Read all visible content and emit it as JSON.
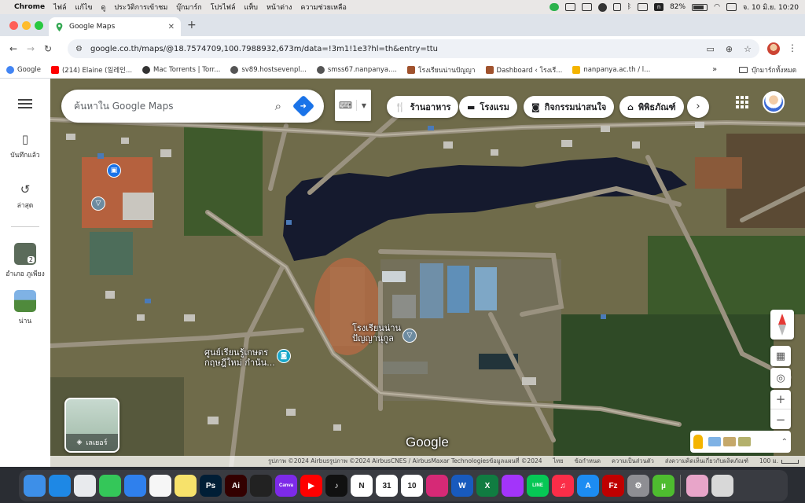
{
  "menubar": {
    "items": [
      "Chrome",
      "ไฟล์",
      "แก้ไข",
      "ดู",
      "ประวัติการเข้าชม",
      "บุ๊กมาร์ก",
      "โปรไฟล์",
      "แท็บ",
      "หน้าต่าง",
      "ความช่วยเหลือ"
    ],
    "battery": "82%",
    "clock": "จ. 10 มิ.ย.  10:20"
  },
  "browser": {
    "tab_title": "Google Maps",
    "url": "google.co.th/maps/@18.7574709,100.7988932,673m/data=!3m1!1e3?hl=th&entry=ttu",
    "bookmarks": [
      {
        "label": "Google",
        "color": "#4285f4"
      },
      {
        "label": "(214) Elaine (일레인...",
        "color": "#ff0000"
      },
      {
        "label": "Mac Torrents | Torr...",
        "color": "#333333"
      },
      {
        "label": "sv89.hostsevenpl...",
        "color": "#555555"
      },
      {
        "label": "smss67.nanpanya....",
        "color": "#555555"
      },
      {
        "label": "โรงเรียนน่านปัญญา",
        "color": "#a0522d"
      },
      {
        "label": "Dashboard ‹ โรงเรี...",
        "color": "#a0522d"
      },
      {
        "label": "nanpanya.ac.th / l...",
        "color": "#f4b400"
      }
    ],
    "bookmarks_more": "»",
    "bookmarks_folder": "บุ๊กมาร์กทั้งหมด"
  },
  "rail": {
    "saved_label": "บันทึกแล้ว",
    "recent_label": "ล่าสุด",
    "recent_place_1": "อำเภอ ภูเพียง",
    "recent_place_1_badge": "2",
    "recent_place_2": "น่าน"
  },
  "search": {
    "placeholder": "ค้นหาใน Google Maps"
  },
  "chips": {
    "restaurants": "ร้านอาหาร",
    "hotels": "โรงแรม",
    "things_to_do": "กิจกรรมน่าสนใจ",
    "museums": "พิพิธภัณฑ์"
  },
  "map": {
    "label_school": "โรงเรียนน่าน\nปัญญานุกูล",
    "label_center": "ศูนย์เรียนรู้เกษตร\nกฤษฎีใหม่ กำนัน...",
    "layers_label": "เลเยอร์",
    "logo": "Google",
    "attribution": "รูปภาพ ©2024 Airbusรูปภาพ ©2024 AirbusCNES / AirbusMaxar Technologiesข้อมูลแผนที่ ©2024",
    "footer_links": [
      "ไทย",
      "ข้อกำหนด",
      "ความเป็นส่วนตัว",
      "ส่งความคิดเห็นเกี่ยวกับผลิตภัณฑ์"
    ],
    "scale": "100 ม."
  },
  "dock": {
    "apps": [
      {
        "name": "Finder",
        "color": "#3d8fe8",
        "glyph": ""
      },
      {
        "name": "Safari",
        "color": "#1e88e5",
        "glyph": ""
      },
      {
        "name": "Chrome",
        "color": "#e8eaed",
        "glyph": ""
      },
      {
        "name": "Messages",
        "color": "#34c759",
        "glyph": ""
      },
      {
        "name": "Mail",
        "color": "#2f80ed",
        "glyph": ""
      },
      {
        "name": "Photos",
        "color": "#f6f6f6",
        "glyph": ""
      },
      {
        "name": "Notes",
        "color": "#f7e26b",
        "glyph": ""
      },
      {
        "name": "Photoshop",
        "color": "#001e36",
        "glyph": "Ps"
      },
      {
        "name": "Illustrator",
        "color": "#330000",
        "glyph": "Ai"
      },
      {
        "name": "Final Cut",
        "color": "#222222",
        "glyph": ""
      },
      {
        "name": "Canva",
        "color": "#7d2ae8",
        "glyph": "Canva"
      },
      {
        "name": "YouTube",
        "color": "#ff0000",
        "glyph": "▶"
      },
      {
        "name": "TikTok",
        "color": "#111111",
        "glyph": "♪"
      },
      {
        "name": "Notion",
        "color": "#ffffff",
        "glyph": "N"
      },
      {
        "name": "Calendar-31",
        "color": "#ffffff",
        "glyph": "31"
      },
      {
        "name": "Calendar",
        "color": "#ffffff",
        "glyph": "10"
      },
      {
        "name": "Instagram",
        "color": "#d62976",
        "glyph": ""
      },
      {
        "name": "Word",
        "color": "#185abd",
        "glyph": "W"
      },
      {
        "name": "Excel",
        "color": "#107c41",
        "glyph": "X"
      },
      {
        "name": "Messenger",
        "color": "#a334fa",
        "glyph": ""
      },
      {
        "name": "LINE",
        "color": "#06c755",
        "glyph": "LINE"
      },
      {
        "name": "Music",
        "color": "#fa2d48",
        "glyph": "♫"
      },
      {
        "name": "App Store",
        "color": "#1c8cf2",
        "glyph": "A"
      },
      {
        "name": "FileZilla",
        "color": "#bf0000",
        "glyph": "Fz"
      },
      {
        "name": "Settings",
        "color": "#8e8e93",
        "glyph": "⚙"
      },
      {
        "name": "uTorrent",
        "color": "#4ebc2f",
        "glyph": "µ"
      },
      {
        "name": "Preview",
        "color": "#e8a5c9",
        "glyph": ""
      },
      {
        "name": "Trash",
        "color": "#d8d8d8",
        "glyph": ""
      }
    ]
  }
}
